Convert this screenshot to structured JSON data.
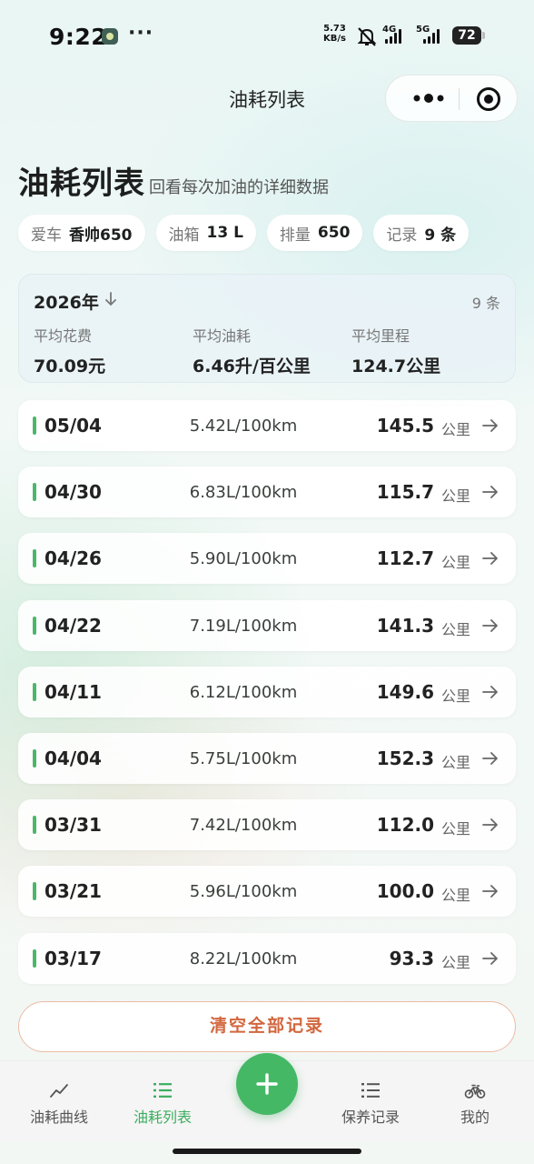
{
  "status_bar": {
    "time": "9:22",
    "dots": "···",
    "net_speed_value": "5.73",
    "net_speed_unit": "KB/s",
    "net_4g": "4G",
    "net_5g": "5G",
    "battery": "72"
  },
  "nav": {
    "title": "油耗列表"
  },
  "header": {
    "title": "油耗列表",
    "subtitle": "回看每次加油的详细数据"
  },
  "chips": [
    {
      "label": "爱车",
      "value": "香帅650"
    },
    {
      "label": "油箱",
      "value": "13 L"
    },
    {
      "label": "排量",
      "value": "650"
    },
    {
      "label": "记录",
      "value": "9 条"
    }
  ],
  "summary": {
    "year": "2026年",
    "count": "9 条",
    "stats": [
      {
        "label": "平均花费",
        "value": "70.09元"
      },
      {
        "label": "平均油耗",
        "value": "6.46升/百公里"
      },
      {
        "label": "平均里程",
        "value": "124.7公里"
      }
    ]
  },
  "records": [
    {
      "date": "05/04",
      "consumption": "5.42L/100km",
      "distance": "145.5",
      "unit": "公里"
    },
    {
      "date": "04/30",
      "consumption": "6.83L/100km",
      "distance": "115.7",
      "unit": "公里"
    },
    {
      "date": "04/26",
      "consumption": "5.90L/100km",
      "distance": "112.7",
      "unit": "公里"
    },
    {
      "date": "04/22",
      "consumption": "7.19L/100km",
      "distance": "141.3",
      "unit": "公里"
    },
    {
      "date": "04/11",
      "consumption": "6.12L/100km",
      "distance": "149.6",
      "unit": "公里"
    },
    {
      "date": "04/04",
      "consumption": "5.75L/100km",
      "distance": "152.3",
      "unit": "公里"
    },
    {
      "date": "03/31",
      "consumption": "7.42L/100km",
      "distance": "112.0",
      "unit": "公里"
    },
    {
      "date": "03/21",
      "consumption": "5.96L/100km",
      "distance": "100.0",
      "unit": "公里"
    },
    {
      "date": "03/17",
      "consumption": "8.22L/100km",
      "distance": "93.3",
      "unit": "公里"
    }
  ],
  "clear_button": "清空全部记录",
  "tabs": [
    {
      "label": "油耗曲线",
      "icon": "line-chart-icon",
      "active": false
    },
    {
      "label": "油耗列表",
      "icon": "list-icon",
      "active": true
    },
    {
      "label": "保养记录",
      "icon": "list-icon",
      "active": false
    },
    {
      "label": "我的",
      "icon": "bicycle-icon",
      "active": false
    }
  ],
  "colors": {
    "accent_green": "#45b866",
    "danger_orange": "#d2673f"
  }
}
